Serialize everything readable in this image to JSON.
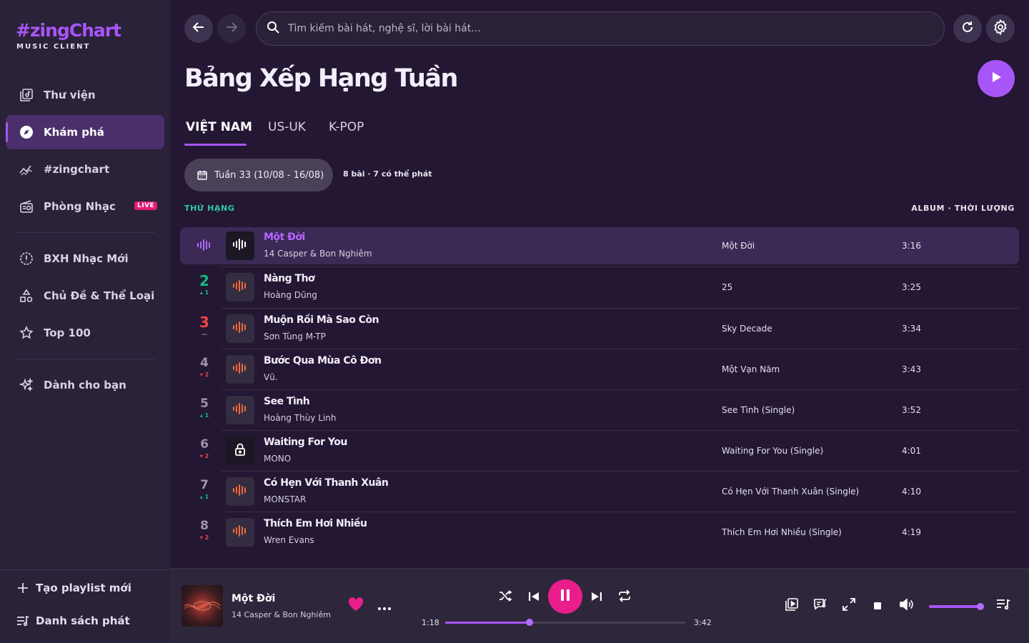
{
  "brand": {
    "title": "#zingChart",
    "subtitle": "MUSIC CLIENT"
  },
  "sidebar": {
    "items": [
      {
        "label": "Thư viện"
      },
      {
        "label": "Khám phá"
      },
      {
        "label": "#zingchart"
      },
      {
        "label": "Phòng Nhạc",
        "badge": "LIVE"
      },
      {
        "label": "BXH Nhạc Mới"
      },
      {
        "label": "Chủ Đề & Thể Loại"
      },
      {
        "label": "Top 100"
      },
      {
        "label": "Dành cho bạn"
      }
    ],
    "new_playlist": "Tạo playlist mới",
    "playlist": "Danh sách phát"
  },
  "search": {
    "placeholder": "Tìm kiếm bài hát, nghệ sĩ, lời bài hát..."
  },
  "page": {
    "title": "Bảng Xếp Hạng Tuần"
  },
  "tabs": [
    {
      "label": "VIỆT NAM"
    },
    {
      "label": "US-UK"
    },
    {
      "label": "K-POP"
    }
  ],
  "week": {
    "label": "Tuần 33 (10/08 - 16/08)",
    "meta": "8 bài · 7 có thể phát"
  },
  "columns": {
    "rank": "THỨ HẠNG",
    "right": "ALBUM · THỜI LƯỢNG"
  },
  "colors": {
    "accent": "#a855f7",
    "up": "#10b981",
    "down": "#ef4444",
    "pause": "#e91e8c"
  },
  "songs": [
    {
      "rank": "",
      "trend": "",
      "title": "Một Đời",
      "artist": "14 Casper & Bon Nghiêm",
      "album": "Một Đời",
      "duration": "3:16"
    },
    {
      "rank": "2",
      "trend": "▴ 1",
      "title": "Nàng Thơ",
      "artist": "Hoàng Dũng",
      "album": "25",
      "duration": "3:25"
    },
    {
      "rank": "3",
      "trend": "—",
      "title": "Muộn Rồi Mà Sao Còn",
      "artist": "Sơn Tùng M-TP",
      "album": "Sky Decade",
      "duration": "3:34"
    },
    {
      "rank": "4",
      "trend": "▾ 2",
      "title": "Bước Qua Mùa Cô Đơn",
      "artist": "Vũ.",
      "album": "Một Vạn Năm",
      "duration": "3:43"
    },
    {
      "rank": "5",
      "trend": "▴ 1",
      "title": "See Tình",
      "artist": "Hoàng Thùy Linh",
      "album": "See Tình (Single)",
      "duration": "3:52"
    },
    {
      "rank": "6",
      "trend": "▾ 2",
      "title": "Waiting For You",
      "artist": "MONO",
      "album": "Waiting For You (Single)",
      "duration": "4:01"
    },
    {
      "rank": "7",
      "trend": "▴ 1",
      "title": "Có Hẹn Với Thanh Xuân",
      "artist": "MONSTAR",
      "album": "Có Hẹn Với Thanh Xuân (Single)",
      "duration": "4:10"
    },
    {
      "rank": "8",
      "trend": "▾ 2",
      "title": "Thích Em Hơi Nhiều",
      "artist": "Wren Evans",
      "album": "Thích Em Hơi Nhiều (Single)",
      "duration": "4:19"
    }
  ],
  "player": {
    "title": "Một Đời",
    "artist": "14 Casper & Bon Nghiêm",
    "elapsed": "1:18",
    "total": "3:42",
    "progress": 0.35,
    "volume": 0.95
  }
}
